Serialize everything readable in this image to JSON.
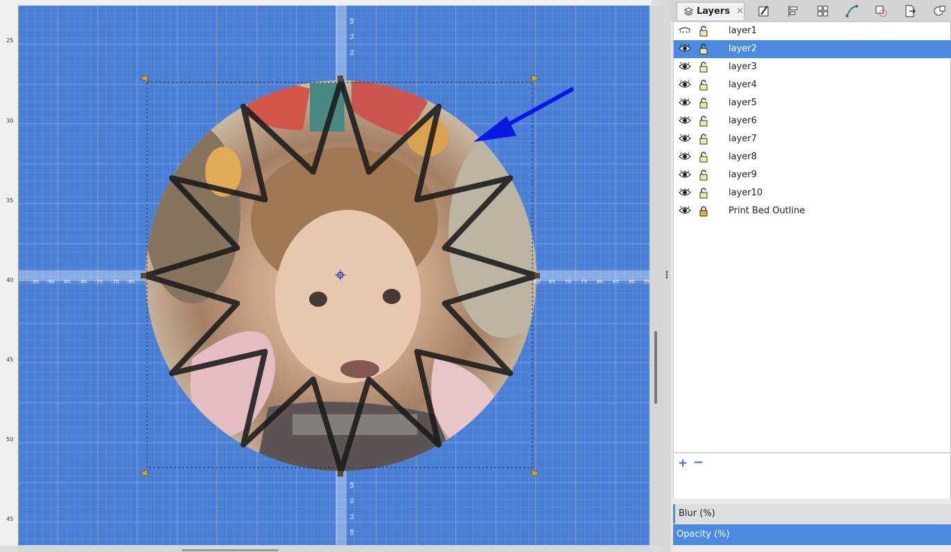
{
  "panel": {
    "tab_label": "Layers",
    "tab_close": "✕",
    "toolbar_icons": [
      "fill-stroke-icon",
      "align-icon",
      "arrange-icon",
      "path-effects-icon",
      "clip-icon",
      "export-icon",
      "objects-icon"
    ]
  },
  "layers": [
    {
      "name": "layer1",
      "visible": false,
      "locked": false,
      "selected": false
    },
    {
      "name": "layer2",
      "visible": true,
      "locked": false,
      "selected": true
    },
    {
      "name": "layer3",
      "visible": true,
      "locked": false,
      "selected": false
    },
    {
      "name": "layer4",
      "visible": true,
      "locked": false,
      "selected": false
    },
    {
      "name": "layer5",
      "visible": true,
      "locked": false,
      "selected": false
    },
    {
      "name": "layer6",
      "visible": true,
      "locked": false,
      "selected": false
    },
    {
      "name": "layer7",
      "visible": true,
      "locked": false,
      "selected": false
    },
    {
      "name": "layer8",
      "visible": true,
      "locked": false,
      "selected": false
    },
    {
      "name": "layer9",
      "visible": true,
      "locked": false,
      "selected": false
    },
    {
      "name": "layer10",
      "visible": true,
      "locked": false,
      "selected": false
    },
    {
      "name": "Print Bed Outline",
      "visible": true,
      "locked": true,
      "selected": false
    }
  ],
  "actions": {
    "add": "+",
    "remove": "−"
  },
  "sections": {
    "blur": "Blur (%)",
    "opacity": "Opacity (%)"
  },
  "rulers": {
    "left_labels": [
      "25",
      "30",
      "35",
      "40",
      "45",
      "50",
      "45"
    ],
    "axis_labels_left": [
      "-95",
      "-90",
      "-85",
      "-80",
      "-75",
      "-70",
      "-65"
    ],
    "axis_labels_right": [
      "60",
      "65",
      "70",
      "75",
      "80",
      "85",
      "90",
      "95"
    ],
    "axis_labels_top": [
      "85",
      "75",
      "70"
    ],
    "axis_labels_bottom": [
      "65",
      "70",
      "75",
      "80"
    ]
  },
  "colors": {
    "canvas": "#4a7fd5",
    "selection": "#4a8ae0",
    "arrow": "#0a18e6"
  }
}
